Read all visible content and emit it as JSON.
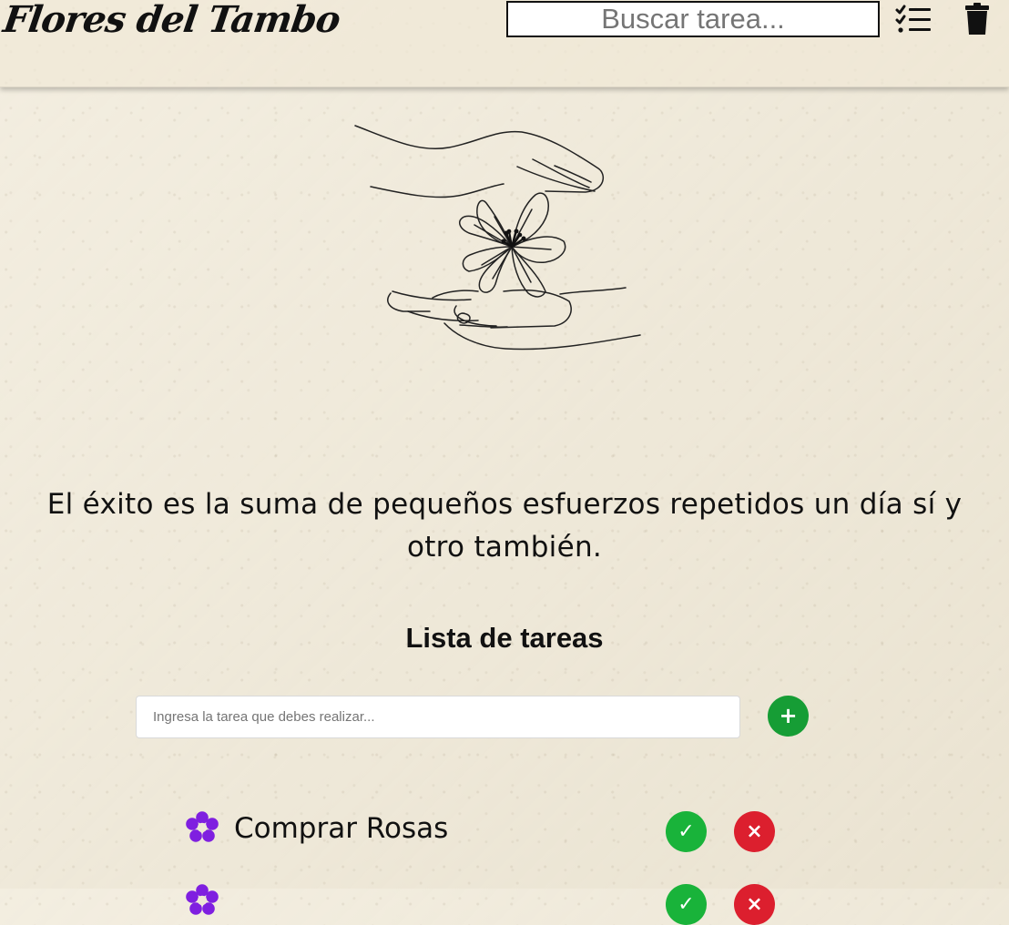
{
  "header": {
    "logo_text": "Flores del Tambo",
    "search": {
      "value": "",
      "placeholder": "Buscar tarea..."
    },
    "icons": {
      "list": "checklist-icon",
      "delete": "trash-icon"
    }
  },
  "main": {
    "quote": "El éxito es la suma de pequeños esfuerzos repetidos un día sí y otro también.",
    "list_title": "Lista de tareas",
    "new_task": {
      "value": "",
      "placeholder": "Ingresa la tarea que debes realizar..."
    },
    "actions": {
      "add": "+",
      "done": "✓",
      "remove": "×"
    },
    "tasks": [
      {
        "label": "Comprar Rosas",
        "icon": "flower-icon"
      },
      {
        "label": "",
        "icon": "flower-icon"
      }
    ]
  },
  "colors": {
    "background": "#efe8d6",
    "accent_purple": "#7f1fe0",
    "add_green": "#169d35",
    "done_green": "#19b33a",
    "delete_red": "#dc1f2e",
    "text_black": "#111111"
  }
}
